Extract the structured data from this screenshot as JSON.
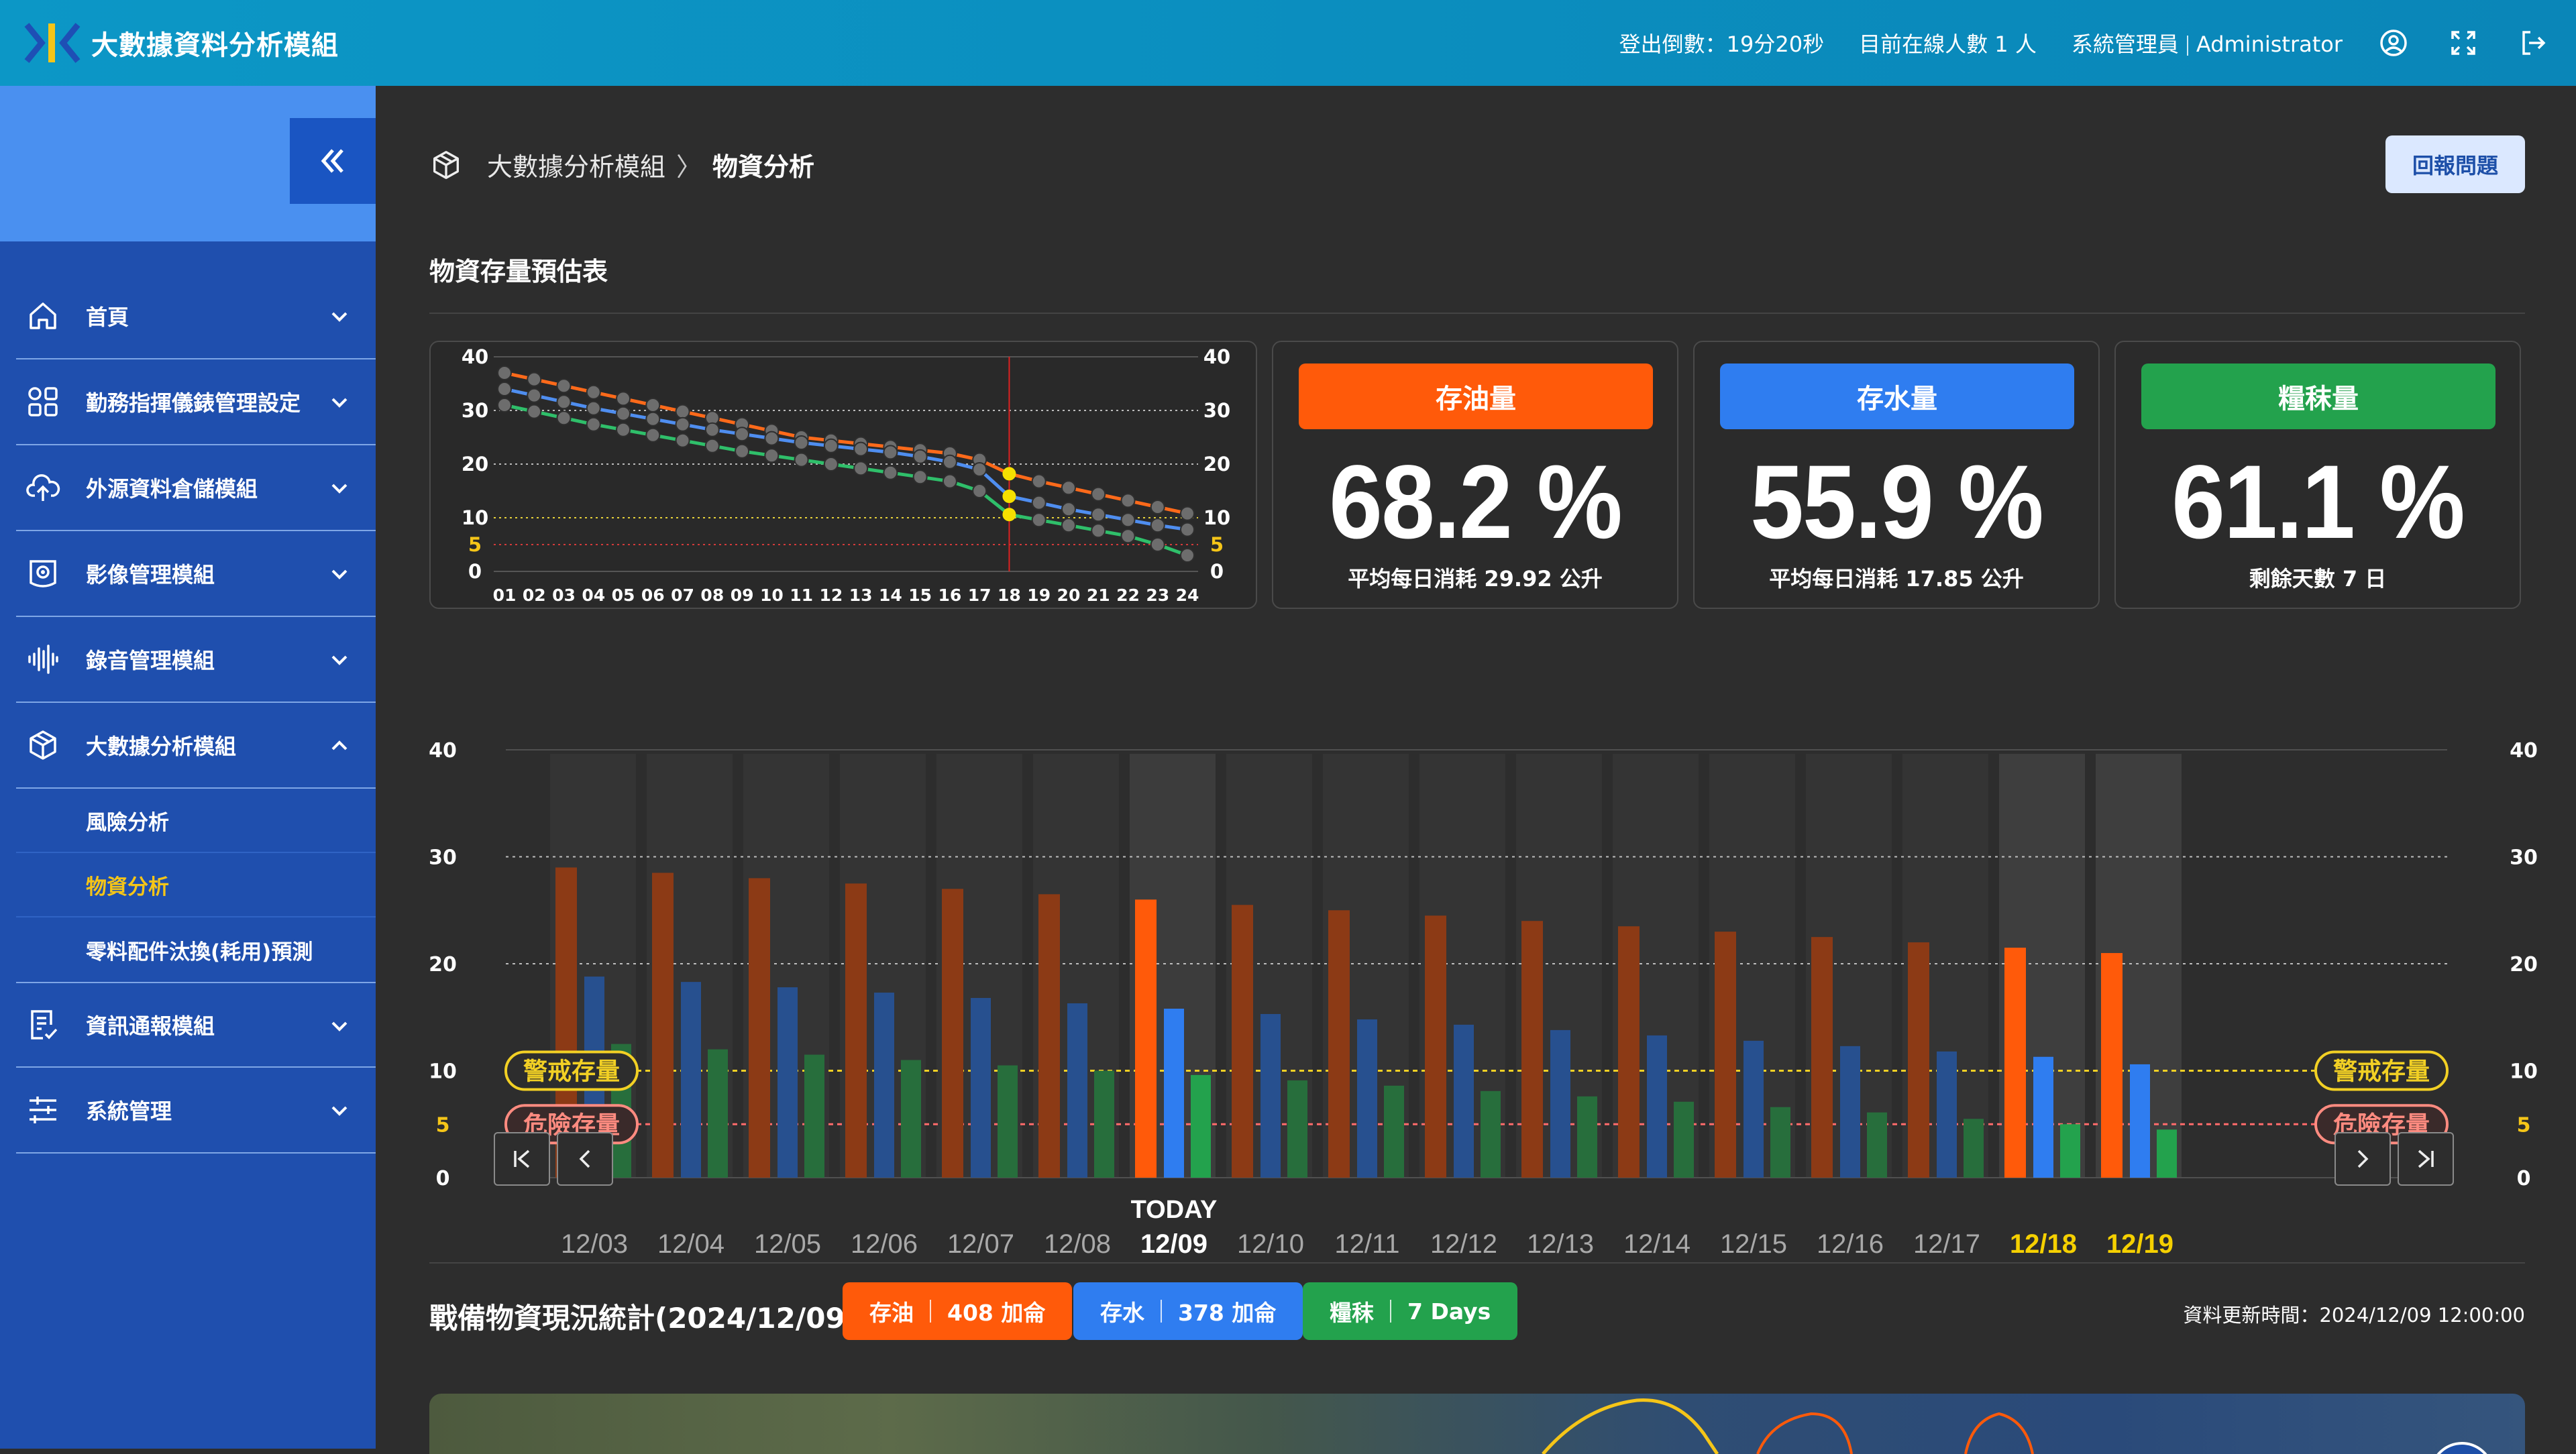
{
  "header": {
    "title": "大數據資料分析模組",
    "logout_countdown": "登出倒數：19分20秒",
    "online_users": "目前在線人數 1 人",
    "role": "系統管理員",
    "user": "Administrator",
    "icons": [
      "user-circle-icon",
      "fullscreen-icon",
      "logout-icon"
    ]
  },
  "sidebar": {
    "items": [
      {
        "label": "首頁",
        "icon": "home-icon"
      },
      {
        "label": "勤務指揮儀錶管理設定",
        "icon": "grid-icon"
      },
      {
        "label": "外源資料倉儲模組",
        "icon": "cloud-upload-icon"
      },
      {
        "label": "影像管理模組",
        "icon": "camera-icon"
      },
      {
        "label": "錄音管理模組",
        "icon": "audio-wave-icon"
      },
      {
        "label": "大數據分析模組",
        "icon": "cube-icon"
      },
      {
        "label": "資訊通報模組",
        "icon": "report-icon"
      },
      {
        "label": "系統管理",
        "icon": "sliders-icon"
      }
    ],
    "sub_items": [
      "風險分析",
      "物資分析",
      "零料配件汰換(耗用)預測"
    ],
    "active_sub": "物資分析"
  },
  "breadcrumb": {
    "parent": "大數據分析模組",
    "sep": "〉",
    "current": "物資分析"
  },
  "report_button": "回報問題",
  "section_title": "物資存量預估表",
  "cards": [
    {
      "title": "存油量",
      "value": "68.2 %",
      "sub": "平均每日消耗 29.92 公升",
      "color": "#ff5a0a"
    },
    {
      "title": "存水量",
      "value": "55.9 %",
      "sub": "平均每日消耗 17.85 公升",
      "color": "#2f7df0"
    },
    {
      "title": "糧秣量",
      "value": "61.1 %",
      "sub": "剩餘天數 7 日",
      "color": "#23a24d"
    }
  ],
  "chart_data": [
    {
      "type": "line",
      "x": [
        "01",
        "02",
        "03",
        "04",
        "05",
        "06",
        "07",
        "08",
        "09",
        "10",
        "11",
        "12",
        "13",
        "14",
        "15",
        "16",
        "17",
        "18",
        "19",
        "20",
        "21",
        "22",
        "23",
        "24"
      ],
      "ylim": [
        0,
        40
      ],
      "yticks": [
        0,
        5,
        10,
        20,
        30,
        40
      ],
      "marker_x": "18",
      "grid": true,
      "series": [
        {
          "color": "#ff6a1a",
          "values": [
            37,
            35.8,
            34.6,
            33.4,
            32.2,
            31,
            29.8,
            28.6,
            27.4,
            26.2,
            25,
            24.4,
            23.8,
            23.2,
            22.6,
            22,
            20.8,
            18.2,
            16.8,
            15.6,
            14.4,
            13.2,
            12,
            10.8
          ]
        },
        {
          "color": "#4f8ef0",
          "values": [
            34,
            32.8,
            31.6,
            30.4,
            29.4,
            28.4,
            27.4,
            26.4,
            25.6,
            24.8,
            24,
            23.4,
            22.8,
            22.2,
            21.4,
            20.4,
            19,
            14,
            12.8,
            11.6,
            10.6,
            9.6,
            8.6,
            7.8
          ]
        },
        {
          "color": "#2fbf6a",
          "values": [
            31,
            29.8,
            28.6,
            27.4,
            26.4,
            25.4,
            24.4,
            23.4,
            22.4,
            21.6,
            20.8,
            20,
            19.2,
            18.4,
            17.6,
            16.8,
            15,
            10.6,
            9.6,
            8.6,
            7.6,
            6.6,
            5,
            3
          ]
        }
      ]
    },
    {
      "type": "bar",
      "categories": [
        "12/03",
        "12/04",
        "12/05",
        "12/06",
        "12/07",
        "12/08",
        "12/09",
        "12/10",
        "12/11",
        "12/12",
        "12/13",
        "12/14",
        "12/15",
        "12/16",
        "12/17",
        "12/18",
        "12/19"
      ],
      "today_label": "TODAY",
      "today_index": 6,
      "forecast_indices": [
        15,
        16
      ],
      "ylim": [
        0,
        40
      ],
      "yticks": [
        0,
        5,
        10,
        20,
        30,
        40
      ],
      "warning_level": 10,
      "danger_level": 5,
      "warning_label": "警戒存量",
      "danger_label": "危險存量",
      "series": [
        {
          "color": "#ff5a0a",
          "values": [
            29,
            28.5,
            28,
            27.5,
            27,
            26.5,
            26,
            25.5,
            25,
            24.5,
            24,
            23.5,
            23,
            22.5,
            22,
            21.5,
            21
          ]
        },
        {
          "color": "#2f7df0",
          "values": [
            18.8,
            18.3,
            17.8,
            17.3,
            16.8,
            16.3,
            15.8,
            15.3,
            14.8,
            14.3,
            13.8,
            13.3,
            12.8,
            12.3,
            11.8,
            11.3,
            10.6
          ]
        },
        {
          "color": "#23a24d",
          "values": [
            12.5,
            12,
            11.5,
            11,
            10.5,
            10,
            9.6,
            9.1,
            8.6,
            8.1,
            7.6,
            7.1,
            6.6,
            6.1,
            5.5,
            5,
            4.5
          ]
        }
      ]
    }
  ],
  "stats": {
    "title": "戰備物資現況統計(2024/12/09)",
    "pills": [
      {
        "label": "存油",
        "value": "408 加侖",
        "color": "#ff5a0a"
      },
      {
        "label": "存水",
        "value": "378 加侖",
        "color": "#2f7df0"
      },
      {
        "label": "糧秣",
        "value": "7 Days",
        "color": "#23a24d"
      }
    ],
    "updated": "資料更新時間：2024/12/09 12:00:00"
  }
}
